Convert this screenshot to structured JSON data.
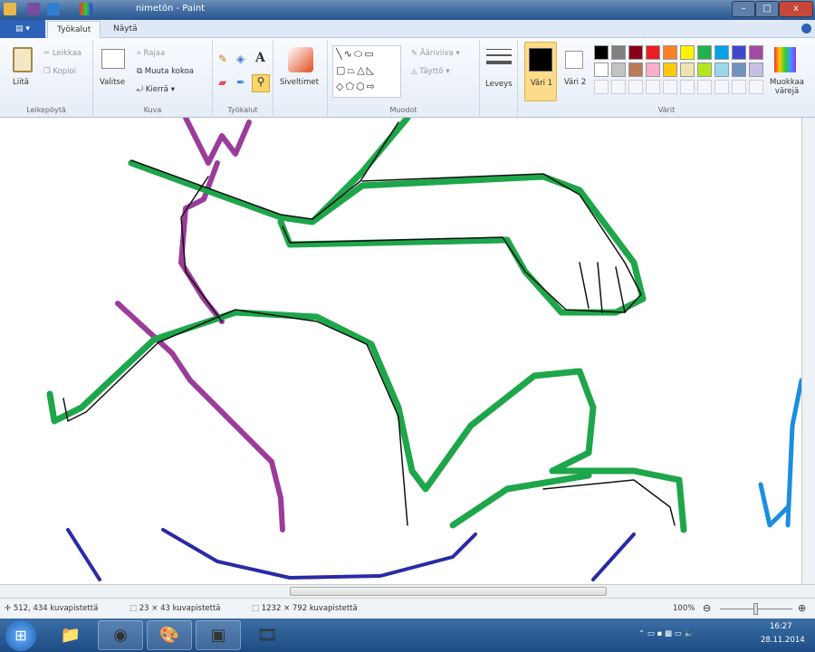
{
  "window": {
    "title": "nimetön - Paint",
    "minimize": "–",
    "maximize": "□",
    "close": "x"
  },
  "tabs": [
    {
      "label": "Työkalut"
    },
    {
      "label": "Näytä"
    }
  ],
  "ribbon": {
    "clipboard": {
      "label": "Leikepöytä",
      "paste": "Liitä",
      "cut": "Leikkaa",
      "copy": "Kopioi"
    },
    "image": {
      "label": "Kuva",
      "select": "Valitse",
      "crop": "Rajaa",
      "resize": "Muuta kokoa",
      "rotate": "Kierrä"
    },
    "tools": {
      "label": "Työkalut"
    },
    "brushes": {
      "label": "Siveltimet"
    },
    "shapes": {
      "label": "Muodot",
      "outline": "Ääriviiva",
      "fill": "Täyttö"
    },
    "size": {
      "label": "Leveys"
    },
    "colors": {
      "label": "Värit",
      "color1": "Väri 1",
      "color2": "Väri 2",
      "edit": "Muokkaa värejä",
      "palette": [
        "#000000",
        "#7f7f7f",
        "#880015",
        "#ed1c24",
        "#ff7f27",
        "#fff200",
        "#22b14c",
        "#00a2e8",
        "#3f48cc",
        "#a349a4",
        "#ffffff",
        "#c3c3c3",
        "#b97a57",
        "#ffaec9",
        "#ffc90e",
        "#efe4b0",
        "#b5e61d",
        "#99d9ea",
        "#7092be",
        "#c8bfe7"
      ],
      "color1_value": "#000000",
      "color2_value": "#ffffff"
    }
  },
  "status": {
    "cursor": "512, 434 kuvapistettä",
    "selection": "23 × 43 kuvapistettä",
    "image_size": "1232 × 792 kuvapistettä",
    "zoom": "100%",
    "zoom_fraction": 0.5
  },
  "taskbar": {
    "time": "16:27",
    "date": "28.11.2014"
  }
}
